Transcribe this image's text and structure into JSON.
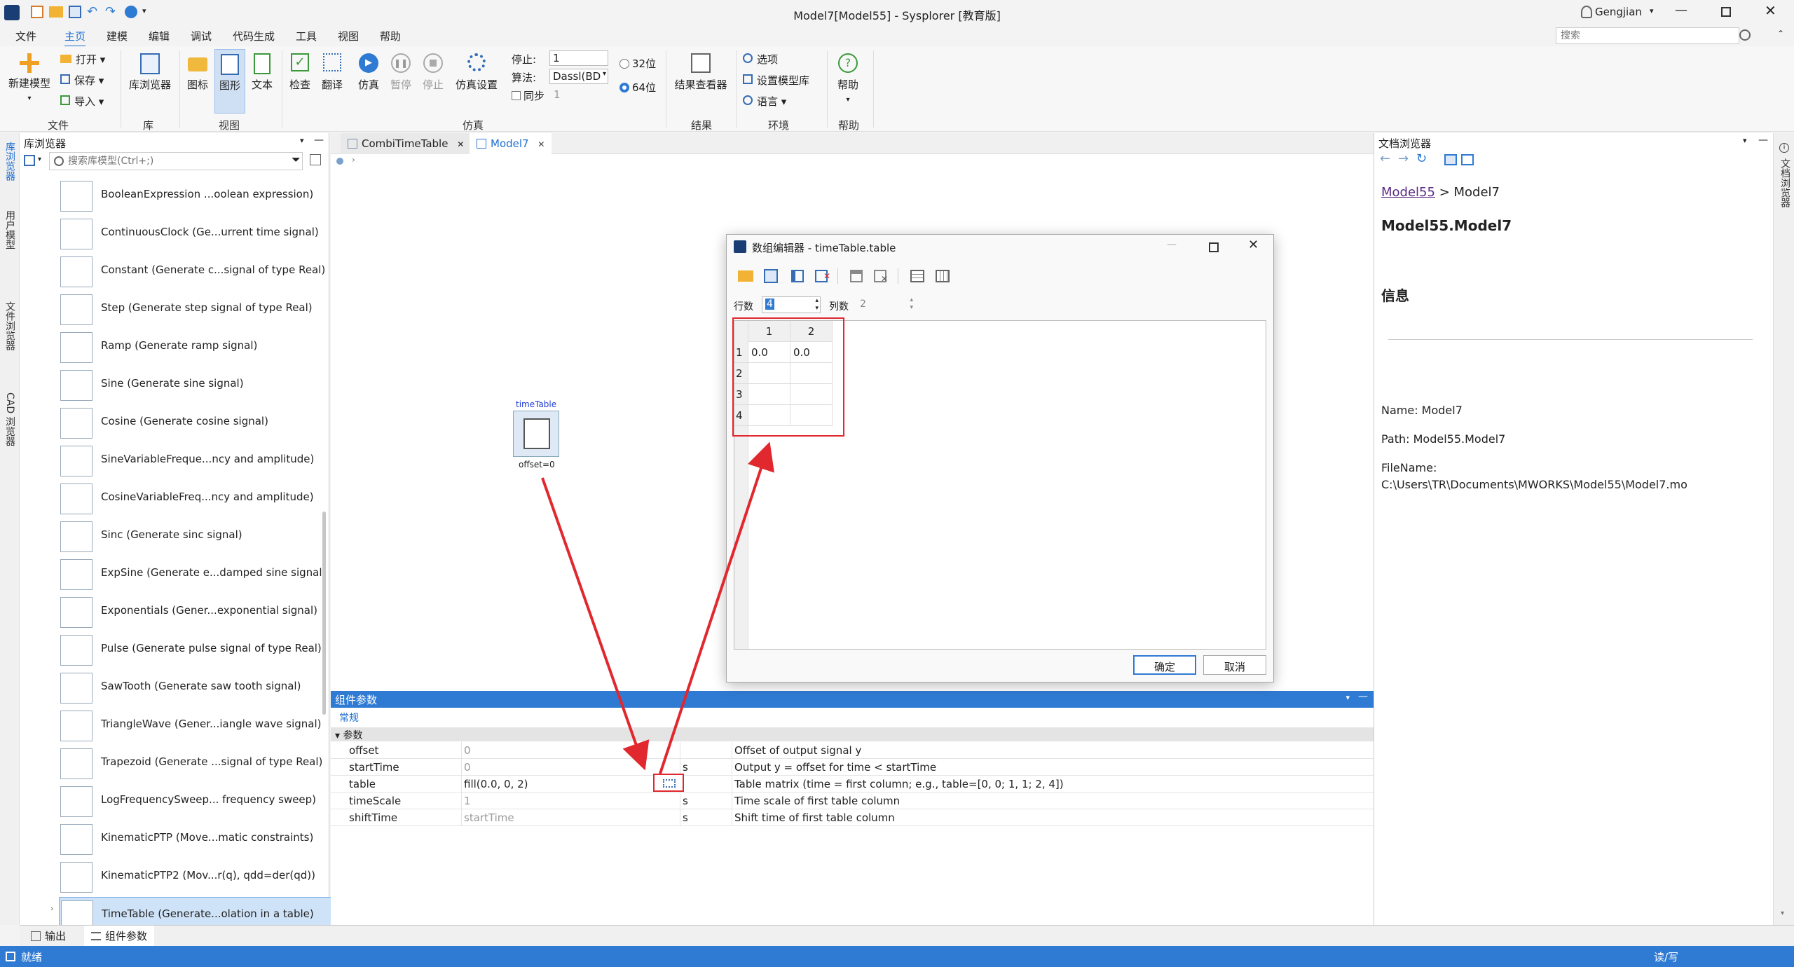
{
  "app": {
    "title": "Model7[Model55] - Sysplorer [教育版]",
    "user": "Gengjian",
    "search_placeholder": "搜索"
  },
  "menu": [
    "文件",
    "主页",
    "建模",
    "编辑",
    "调试",
    "代码生成",
    "工具",
    "视图",
    "帮助"
  ],
  "ribbon": {
    "new_model": "新建模型",
    "open": "打开",
    "save": "保存",
    "import": "导入",
    "group_file": "文件",
    "lib_browser": "库浏览器",
    "group_lib": "库",
    "icon": "图标",
    "diagram": "图形",
    "text": "文本",
    "group_view": "视图",
    "check": "检查",
    "translate": "翻译",
    "simulate": "仿真",
    "pause": "暂停",
    "stop": "停止",
    "sim_settings": "仿真设置",
    "stop_label": "停止:",
    "stop_value": "1",
    "algo_label": "算法:",
    "algo_value": "Dassl(BD",
    "sync": "同步",
    "sync_value": "1",
    "bit32": "32位",
    "bit64": "64位",
    "group_sim": "仿真",
    "result_viewer": "结果查看器",
    "group_result": "结果",
    "options": "选项",
    "set_lib": "设置模型库",
    "language": "语言",
    "group_env": "环境",
    "help": "帮助",
    "group_help": "帮助"
  },
  "left_tabs": [
    "库浏览器",
    "用户模型",
    "文件浏览器",
    "CAD 浏览器"
  ],
  "library": {
    "title": "库浏览器",
    "search_placeholder": "搜索库模型(Ctrl+;)",
    "items": [
      "BooleanExpression ...oolean expression)",
      "ContinuousClock (Ge...urrent time signal)",
      "Constant (Generate c...signal of type Real)",
      "Step (Generate step signal of type Real)",
      "Ramp (Generate ramp signal)",
      "Sine (Generate sine signal)",
      "Cosine (Generate cosine signal)",
      "SineVariableFreque...ncy and amplitude)",
      "CosineVariableFreq...ncy and amplitude)",
      "Sinc (Generate sinc signal)",
      "ExpSine (Generate e...damped sine signal)",
      "Exponentials (Gener...exponential signal)",
      "Pulse (Generate pulse signal of type Real)",
      "SawTooth (Generate saw tooth signal)",
      "TriangleWave (Gener...iangle wave signal)",
      "Trapezoid (Generate ...signal of type Real)",
      "LogFrequencySweep... frequency sweep)",
      "KinematicPTP (Move...matic constraints)",
      "KinematicPTP2 (Mov...r(q), qdd=der(qd))",
      "TimeTable (Generate...olation in a table)"
    ]
  },
  "tabs": [
    "CombiTimeTable",
    "Model7"
  ],
  "canvas": {
    "component_name": "timeTable",
    "component_param": "offset=0"
  },
  "params": {
    "title": "组件参数",
    "tab": "常规",
    "section": "参数",
    "rows": [
      {
        "name": "offset",
        "value": "0",
        "unit": "",
        "desc": "Offset of output signal y"
      },
      {
        "name": "startTime",
        "value": "0",
        "unit": "s",
        "desc": "Output y = offset for time < startTime"
      },
      {
        "name": "table",
        "value": "fill(0.0, 0, 2)",
        "unit": "",
        "desc": "Table matrix (time = first column; e.g., table=[0, 0; 1, 1; 2, 4])"
      },
      {
        "name": "timeScale",
        "value": "1",
        "unit": "s",
        "desc": "Time scale of first table column"
      },
      {
        "name": "shiftTime",
        "value": "startTime",
        "unit": "s",
        "desc": "Shift time of first table column"
      }
    ]
  },
  "dialog": {
    "title": "数组编辑器 - timeTable.table",
    "rows_label": "行数",
    "rows_value": "4",
    "cols_label": "列数",
    "cols_value": "2",
    "col_headers": [
      "1",
      "2"
    ],
    "row_headers": [
      "1",
      "2",
      "3",
      "4"
    ],
    "cells": [
      [
        "0.0",
        "0.0"
      ],
      [
        "",
        ""
      ],
      [
        "",
        ""
      ],
      [
        "",
        ""
      ]
    ],
    "ok": "确定",
    "cancel": "取消"
  },
  "doc": {
    "title": "文档浏览器",
    "breadcrumb_link": "Model55",
    "breadcrumb_sep": ">",
    "breadcrumb_current": "Model7",
    "heading": "Model55.Model7",
    "info": "信息",
    "name": "Name: Model7",
    "path": "Path: Model55.Model7",
    "filename_label": "FileName:",
    "filename": "C:\\Users\\TR\\Documents\\MWORKS\\Model55\\Model7.mo"
  },
  "right_tab": "文档浏览器",
  "bottom_tabs": [
    "输出",
    "组件参数"
  ],
  "status": {
    "left": "就绪",
    "right": "读/写"
  },
  "colors": {
    "accent": "#2f7bd3",
    "highlight": "#e0282e"
  }
}
